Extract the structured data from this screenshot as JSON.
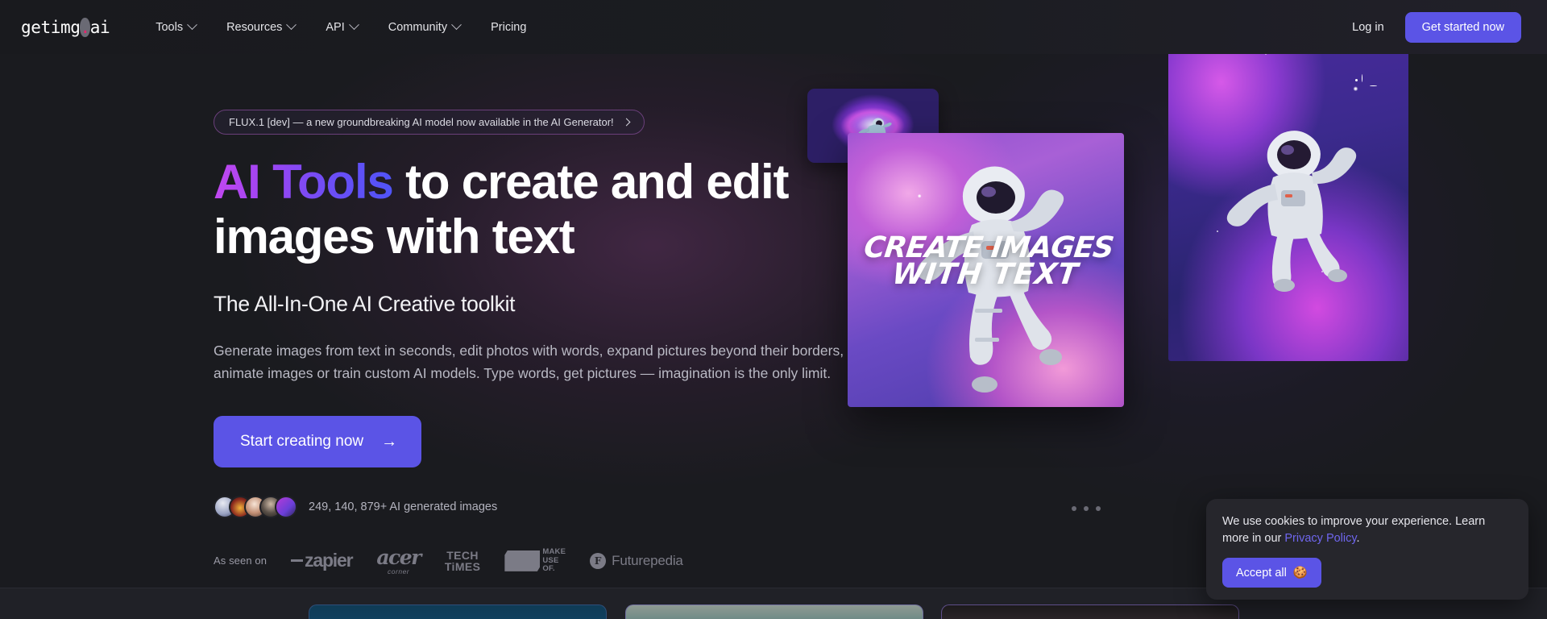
{
  "brand": {
    "name_main": "getimg",
    "name_dot": ".",
    "name_tld": "ai",
    "accent_dot": "#e6256b",
    "accent_button": "#5b54e6"
  },
  "nav": {
    "items": [
      {
        "label": "Tools",
        "has_dropdown": true
      },
      {
        "label": "Resources",
        "has_dropdown": true
      },
      {
        "label": "API",
        "has_dropdown": true
      },
      {
        "label": "Community",
        "has_dropdown": true
      },
      {
        "label": "Pricing",
        "has_dropdown": false
      }
    ],
    "login_label": "Log in",
    "cta_label": "Get started now"
  },
  "hero": {
    "badge_text": "FLUX.1 [dev] — a new groundbreaking AI model now available in the AI Generator!",
    "headline_gradient": "AI Tools",
    "headline_rest": " to create and edit images with text",
    "subheadline": "The All-In-One AI Creative toolkit",
    "body": "Generate images from text in seconds, edit photos with words, expand pictures beyond their borders, animate images or train custom AI models. Type words, get pictures — imagination is the only limit.",
    "cta_label": "Start creating now",
    "cta_arrow": "→",
    "social_proof": "249, 140, 879+ AI generated images",
    "carousel_dots": 3
  },
  "hero_images": {
    "center_card_text_line1": "CREATE IMAGES",
    "center_card_text_line2": "WITH TEXT",
    "alt_small": "astronaut floating in purple nebula vortex",
    "alt_center": "astronaut floating in pink and purple clouds",
    "alt_right": "astronaut reaching upward in a violet starfield"
  },
  "as_seen_on": {
    "label": "As seen on",
    "brands": [
      {
        "name": "zapier",
        "text": "zapier"
      },
      {
        "name": "acer-corner",
        "line1": "acer",
        "line2": "corner"
      },
      {
        "name": "tech-times",
        "line1": "TECH",
        "line2": "TiMES"
      },
      {
        "name": "make-use-of",
        "line1": "MAKE",
        "line2": "USE",
        "line3": "OF."
      },
      {
        "name": "futurepedia",
        "mark": "F",
        "text": "Futurepedia"
      }
    ]
  },
  "cookie_banner": {
    "text_before": "We use cookies to improve your experience. Learn more in our ",
    "link_label": "Privacy Policy",
    "text_after": ".",
    "accept_label": "Accept all",
    "accept_emoji": "🍪"
  }
}
